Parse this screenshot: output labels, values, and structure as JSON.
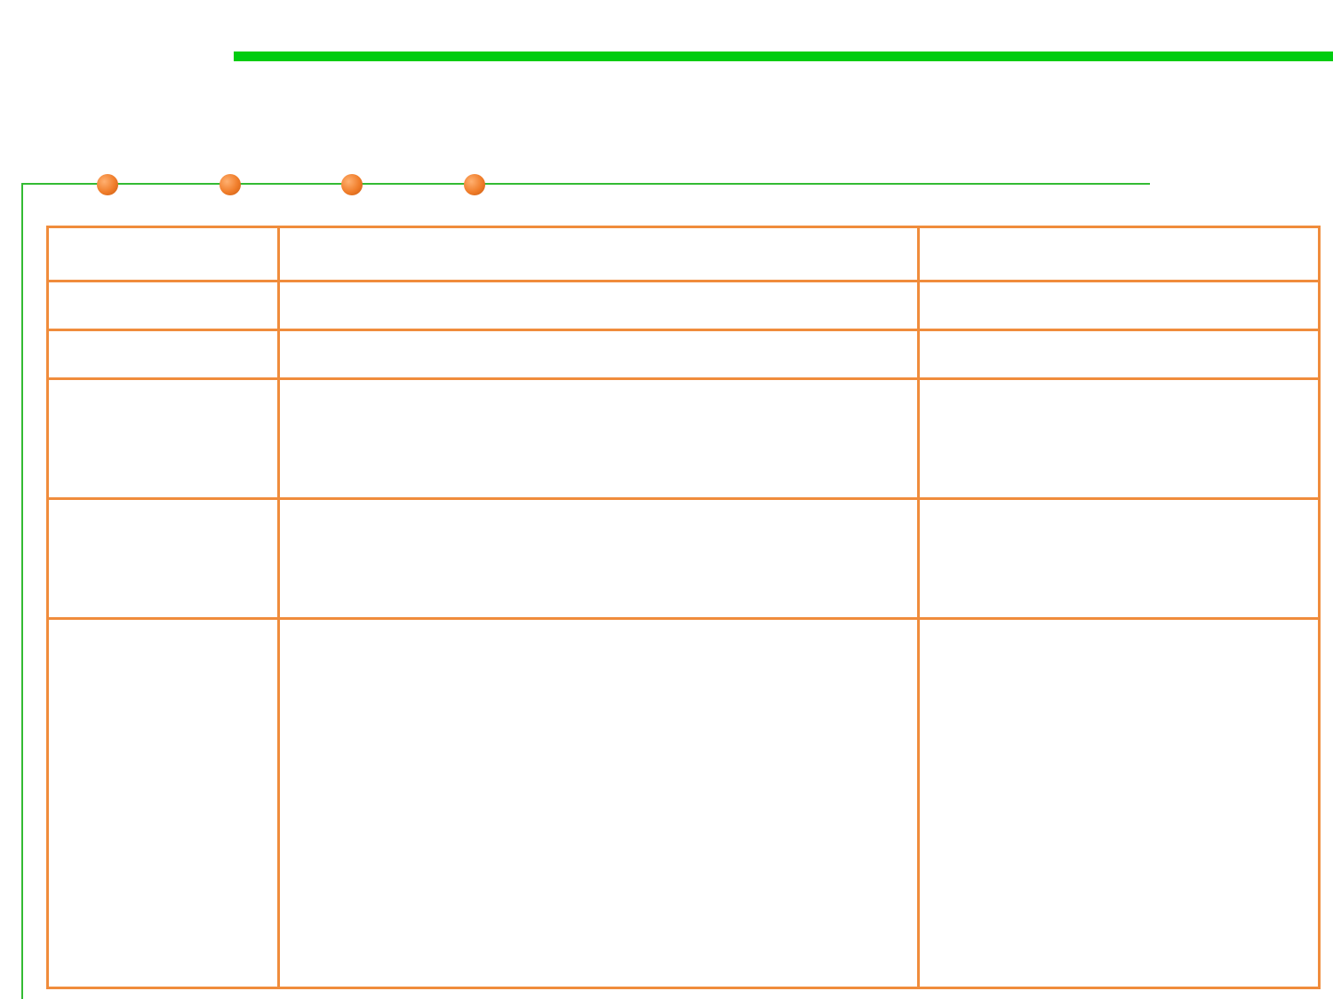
{
  "colors": {
    "title_bar": "#00cc11",
    "frame_line": "#33bb33",
    "dot": "#f07d2a",
    "table_border": "#f08c3c"
  },
  "decorations": {
    "dots": 4
  },
  "table": {
    "columns": 3,
    "rows": [
      [
        "",
        "",
        ""
      ],
      [
        "",
        "",
        ""
      ],
      [
        "",
        "",
        ""
      ],
      [
        "",
        "",
        ""
      ],
      [
        "",
        "",
        ""
      ],
      [
        "",
        "",
        ""
      ]
    ]
  }
}
